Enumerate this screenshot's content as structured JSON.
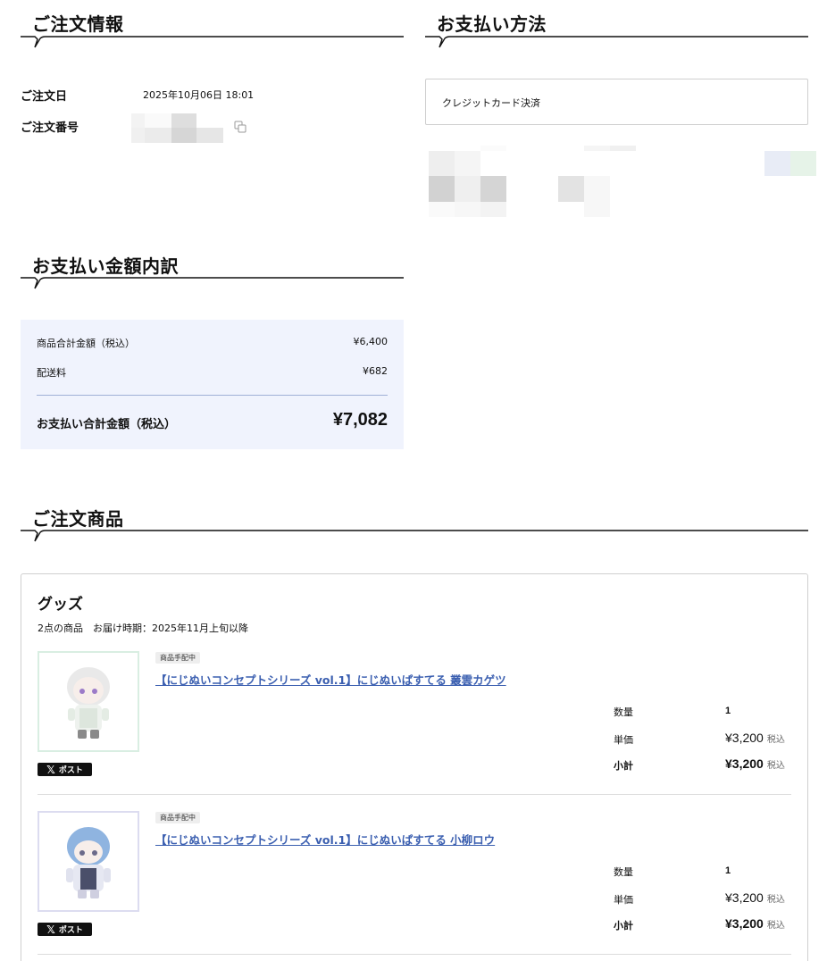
{
  "order_info": {
    "title": "ご注文情報",
    "date_label": "ご注文日",
    "date_value": "2025年10月06日 18:01",
    "number_label": "ご注文番号",
    "copy_icon": "copy-icon"
  },
  "payment_method": {
    "title": "お支払い方法",
    "method": "クレジットカード決済"
  },
  "breakdown": {
    "title": "お支払い金額内訳",
    "subtotal_label": "商品合計金額（税込）",
    "subtotal_value": "¥6,400",
    "shipping_label": "配送料",
    "shipping_value": "¥682",
    "total_label": "お支払い合計金額（税込）",
    "total_value": "¥7,082"
  },
  "ordered_items": {
    "title": "ご注文商品",
    "group_title": "グッズ",
    "group_sub": "2点の商品　お届け時期：2025年11月上旬以降",
    "qty_label": "数量",
    "unit_label": "単価",
    "subtotal_label": "小計",
    "tax_label": "税込",
    "post_label": "ポスト",
    "items": [
      {
        "status": "商品手配中",
        "name": "【にじぬいコンセプトシリーズ vol.1】にじぬいぱすてる 叢雲カゲツ",
        "qty": "1",
        "unit_price": "¥3,200",
        "subtotal": "¥3,200",
        "frame_color": "#d9eee2"
      },
      {
        "status": "商品手配中",
        "name": "【にじぬいコンセプトシリーズ vol.1】にじぬいぱすてる 小柳ロウ",
        "qty": "1",
        "unit_price": "¥3,200",
        "subtotal": "¥3,200",
        "frame_color": "#dcdcf0"
      }
    ]
  }
}
